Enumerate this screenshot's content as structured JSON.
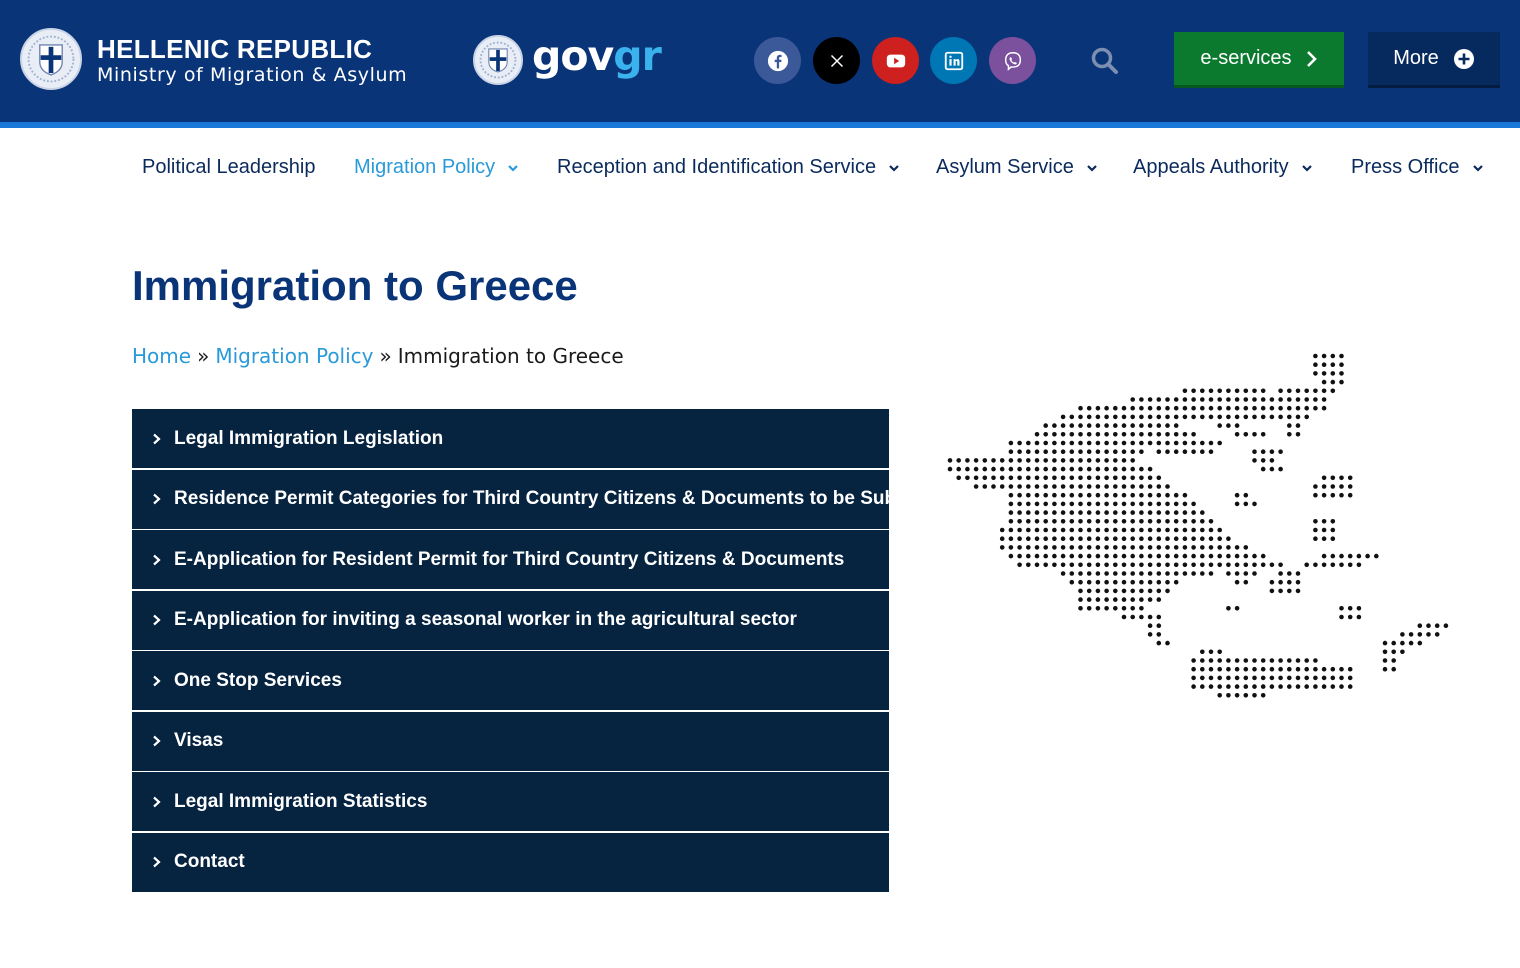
{
  "header": {
    "title": "HELLENIC REPUBLIC",
    "subtitle": "Ministry of Migration & Asylum",
    "govgr_gov": "gov",
    "govgr_gr": "gr",
    "social": [
      {
        "icon": "facebook-icon",
        "color": "#3b5998"
      },
      {
        "icon": "x-twitter-icon",
        "color": "#000000"
      },
      {
        "icon": "youtube-icon",
        "color": "#cd201f"
      },
      {
        "icon": "linkedin-icon",
        "color": "#0077b5"
      },
      {
        "icon": "viber-icon",
        "color": "#7b519d"
      }
    ],
    "eservices_label": "e-services",
    "more_label": "More"
  },
  "nav": {
    "items": [
      {
        "label": "Political Leadership"
      },
      {
        "label": "Migration Policy"
      },
      {
        "label": "Reception and Identification Service"
      },
      {
        "label": "Asylum Service"
      },
      {
        "label": "Appeals Authority"
      },
      {
        "label": "Press Office"
      }
    ]
  },
  "page": {
    "title": "Immigration to Greece",
    "breadcrumb": {
      "home": "Home",
      "sep": "»",
      "parent": "Migration Policy",
      "current": "Immigration to Greece"
    }
  },
  "accordion": {
    "items": [
      {
        "label": "Legal Immigration Legislation"
      },
      {
        "label": "Residence Permit Categories for Third Country Citizens & Documents to be Submitted"
      },
      {
        "label": "E-Application for Resident Permit for Third Country Citizens & Documents"
      },
      {
        "label": "E-Application for inviting a seasonal worker in the agricultural sector"
      },
      {
        "label": "One Stop Services"
      },
      {
        "label": "Visas"
      },
      {
        "label": "Legal Immigration Statistics"
      },
      {
        "label": "Contact"
      }
    ]
  },
  "colors": {
    "header_bg": "#0a3478",
    "accent_blue": "#2a9ad8",
    "accordion_bg": "#062340",
    "eservices_green": "#0b7a2f"
  }
}
